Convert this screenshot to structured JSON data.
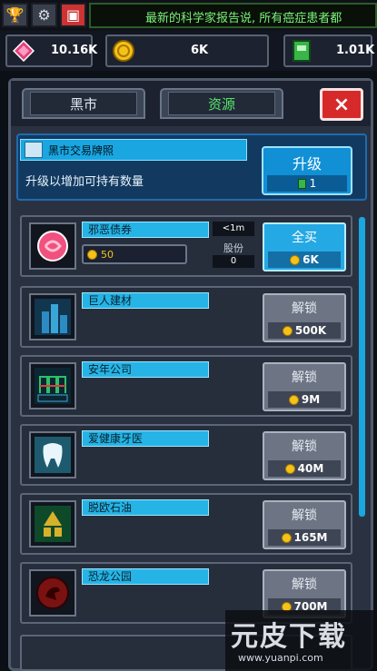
{
  "news_ticker": "最新的科学家报告说, 所有癌症患者都",
  "currencies": {
    "gems": "10.16K",
    "coins": "6K",
    "licenses": "1.01K"
  },
  "tabs": [
    {
      "label": "黑市"
    },
    {
      "label": "资源"
    }
  ],
  "close_label": "×",
  "license": {
    "title": "黑市交易牌照",
    "description": "升级以增加可持有数量",
    "upgrade_label": "升级",
    "upgrade_cost": "1"
  },
  "items": [
    {
      "name": "邪恶债券",
      "owned_coins": "50",
      "timer": "<1m",
      "shares_label": "股份",
      "shares": "0",
      "action": "全买",
      "cost": "6K",
      "icon": "pink-candy-icon",
      "unlocked": true
    },
    {
      "name": "巨人建材",
      "action": "解锁",
      "cost": "500K",
      "icon": "skyscraper-icon"
    },
    {
      "name": "安年公司",
      "action": "解锁",
      "cost": "9M",
      "icon": "erron-logo-icon"
    },
    {
      "name": "爱健康牙医",
      "action": "解锁",
      "cost": "40M",
      "icon": "tooth-icon"
    },
    {
      "name": "脱欧石油",
      "action": "解锁",
      "cost": "165M",
      "icon": "oil-logo-icon"
    },
    {
      "name": "恐龙公园",
      "action": "解锁",
      "cost": "700M",
      "icon": "dino-park-icon"
    }
  ],
  "watermark": {
    "title": "元皮下载",
    "url": "www.yuanpi.com"
  },
  "colors": {
    "accent": "#1aa6e0",
    "close": "#d62a2a",
    "ticker_text": "#7df27a",
    "coin": "#f5c21b"
  }
}
